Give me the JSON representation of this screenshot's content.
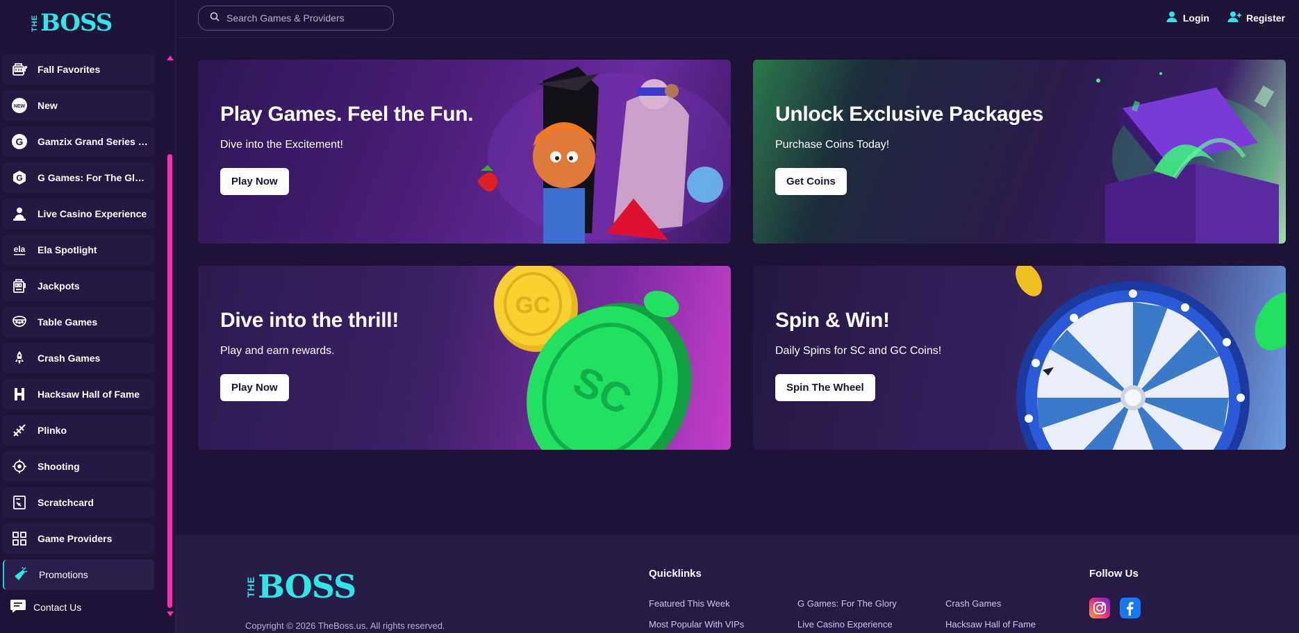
{
  "brand": {
    "logo_small": "THE",
    "logo_main": "BOSS"
  },
  "search": {
    "placeholder": "Search Games & Providers"
  },
  "auth": {
    "login": "Login",
    "register": "Register"
  },
  "sidebar": {
    "items": [
      {
        "label": "Fall Favorites",
        "icon": "slot-machine-icon"
      },
      {
        "label": "New",
        "icon": "new-badge-icon"
      },
      {
        "label": "Gamzix Grand Series R...",
        "icon": "gamzix-icon"
      },
      {
        "label": "G Games: For The Glory",
        "icon": "g-games-icon"
      },
      {
        "label": "Live Casino Experience",
        "icon": "dealer-icon"
      },
      {
        "label": "Ela Spotlight",
        "icon": "ela-icon"
      },
      {
        "label": "Jackpots",
        "icon": "jackpot-icon"
      },
      {
        "label": "Table Games",
        "icon": "table-games-icon"
      },
      {
        "label": "Crash Games",
        "icon": "rocket-icon"
      },
      {
        "label": "Hacksaw Hall of Fame",
        "icon": "hacksaw-icon"
      },
      {
        "label": "Plinko",
        "icon": "plinko-icon"
      },
      {
        "label": "Shooting",
        "icon": "crosshair-icon"
      },
      {
        "label": "Scratchcard",
        "icon": "scratchcard-icon"
      },
      {
        "label": "Game Providers",
        "icon": "grid-icon"
      },
      {
        "label": "Promotions",
        "icon": "megaphone-icon"
      }
    ],
    "contact": "Contact Us"
  },
  "banners": [
    {
      "title": "Play Games. Feel the Fun.",
      "subtitle": "Dive into the Excitement!",
      "button": "Play Now"
    },
    {
      "title": "Unlock Exclusive Packages",
      "subtitle": "Purchase Coins Today!",
      "button": "Get Coins"
    },
    {
      "title": "Dive into the thrill!",
      "subtitle": "Play and earn rewards.",
      "button": "Play Now"
    },
    {
      "title": "Spin & Win!",
      "subtitle": "Daily Spins for SC and GC Coins!",
      "button": "Spin The Wheel"
    }
  ],
  "footer": {
    "copyright": "Copyright © 2026 TheBoss.us. All rights reserved.",
    "quicklinks_title": "Quicklinks",
    "quicklinks": [
      "Featured This Week",
      "G Games: For The Glory",
      "Crash Games",
      "Most Popular With VIPs",
      "Live Casino Experience",
      "Hacksaw Hall of Fame"
    ],
    "follow_title": "Follow Us"
  },
  "colors": {
    "accent": "#2ee6e6",
    "scrollbar": "#ff2bb5",
    "background": "#1e1236"
  }
}
